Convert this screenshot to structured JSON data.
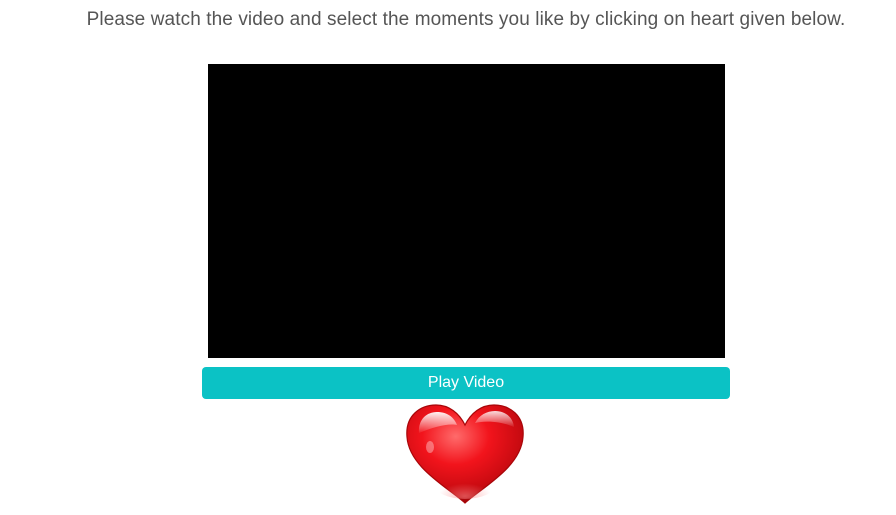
{
  "instruction": {
    "text": "Please watch the video and select the moments you like by clicking on heart given below."
  },
  "video": {
    "background_color": "#000000"
  },
  "play_button": {
    "label": "Play Video",
    "color": "#0bc2c5"
  },
  "heart": {
    "icon": "heart-icon",
    "color": "#e8111b"
  }
}
